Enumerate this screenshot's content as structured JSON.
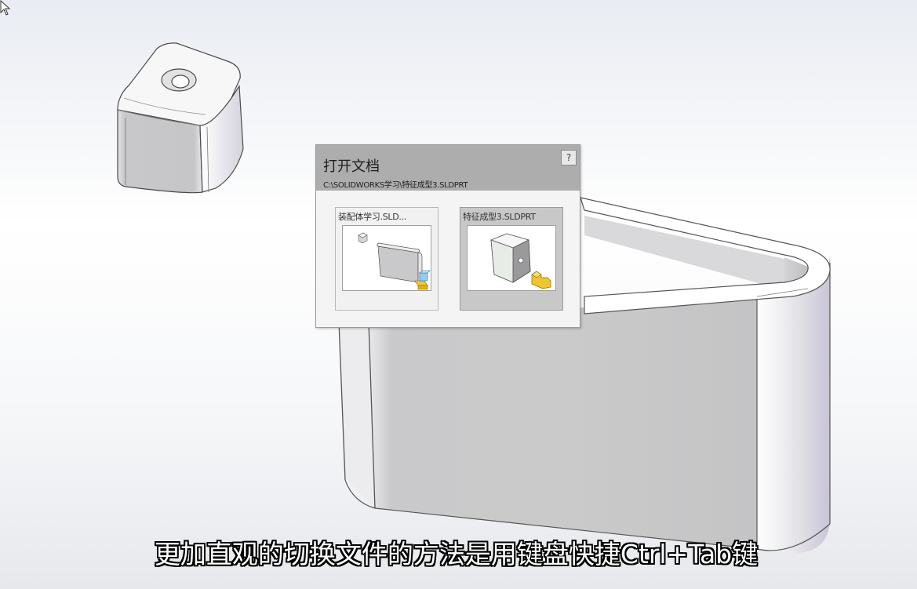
{
  "dialog": {
    "title": "打开文档",
    "path": "C:\\SOLIDWORKS学习\\特征成型3.SLDPRT",
    "help_label": "?",
    "documents": [
      {
        "label": "装配体学习.SLD...",
        "icon": "assembly-document-icon",
        "active": false
      },
      {
        "label": "特征成型3.SLDPRT",
        "icon": "part-document-icon",
        "active": true
      }
    ]
  },
  "subtitle": "更加直观的切换文件的方法是用键盘快捷Ctrl+Tab键",
  "colors": {
    "dialog_header": "#adadad",
    "dialog_body": "#f4f4f4",
    "part_highlight": "#f2c530"
  }
}
